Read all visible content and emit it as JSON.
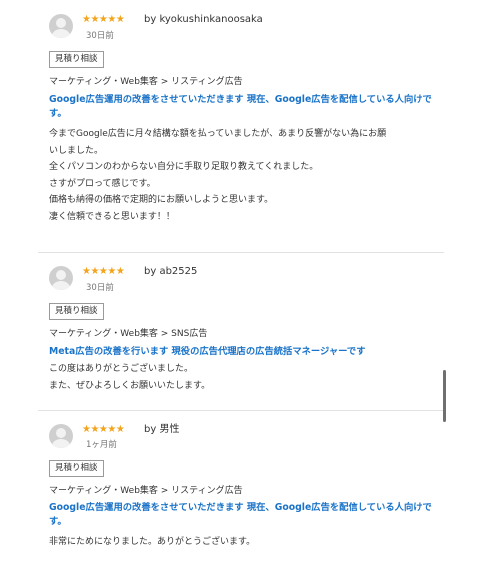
{
  "reviews": [
    {
      "rating": 5,
      "stars": "★★★★★",
      "by": "by kyokushinkanoosaka",
      "date": "30日前",
      "tag": "見積り相談",
      "category": "マーケティング・Web集客 > リスティング広告",
      "title": "Google広告運用の改善をさせていただきます 現在、Google広告を配信している人向けです。",
      "body": [
        "今までGoogle広告に月々結構な額を払っていましたが、あまり反響がない為にお願",
        "いしました。",
        "全くパソコンのわからない自分に手取り足取り教えてくれました。",
        "さすがプロって感じです。",
        "価格も納得の価格で定期的にお願いしようと思います。",
        "凄く信頼できると思います！！"
      ]
    },
    {
      "rating": 5,
      "stars": "★★★★★",
      "by": "by ab2525",
      "date": "30日前",
      "tag": "見積り相談",
      "category": "マーケティング・Web集客 > SNS広告",
      "title": "Meta広告の改善を行います 現役の広告代理店の広告統括マネージャーです",
      "body": [
        "この度はありがとうございました。",
        "また、ぜひよろしくお願いいたします。"
      ]
    },
    {
      "rating": 5,
      "stars": "★★★★★",
      "by": "by 男性",
      "date": "1ヶ月前",
      "tag": "見積り相談",
      "category": "マーケティング・Web集客 > リスティング広告",
      "title": "Google広告運用の改善をさせていただきます 現在、Google広告を配信している人向けです。",
      "body": [
        "非常にためになりました。ありがとうございます。"
      ]
    }
  ],
  "colors": {
    "star": "#f3a41b",
    "link": "#1a73c8"
  }
}
